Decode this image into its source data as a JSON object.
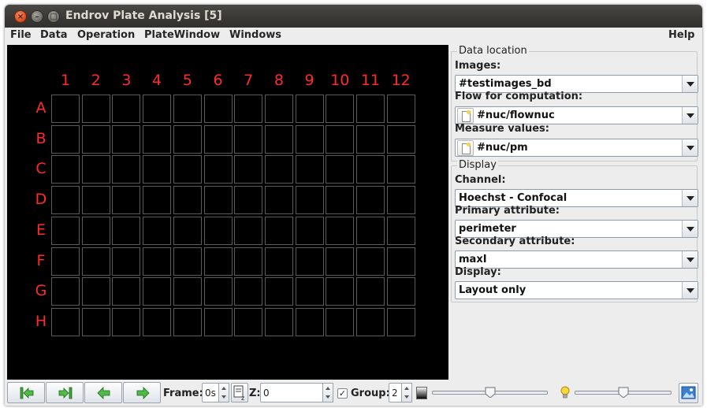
{
  "window": {
    "title": "Endrov Plate Analysis [5]"
  },
  "menu": {
    "file": "File",
    "data": "Data",
    "operation": "Operation",
    "platewindow": "PlateWindow",
    "windows": "Windows",
    "help": "Help"
  },
  "plate": {
    "columns": [
      "1",
      "2",
      "3",
      "4",
      "5",
      "6",
      "7",
      "8",
      "9",
      "10",
      "11",
      "12"
    ],
    "rows": [
      "A",
      "B",
      "C",
      "D",
      "E",
      "F",
      "G",
      "H"
    ],
    "label_color": "#ff2b2b"
  },
  "side": {
    "data_location": {
      "title": "Data location",
      "images_label": "Images:",
      "images_value": "#testimages_bd",
      "flow_label": "Flow for computation:",
      "flow_value": "#nuc/flownuc",
      "measure_label": "Measure values:",
      "measure_value": "#nuc/pm"
    },
    "display": {
      "title": "Display",
      "channel_label": "Channel:",
      "channel_value": "Hoechst - Confocal",
      "primary_label": "Primary attribute:",
      "primary_value": "perimeter",
      "secondary_label": "Secondary attribute:",
      "secondary_value": "maxI",
      "display_label": "Display:",
      "display_value": "Layout only"
    }
  },
  "bottom": {
    "frame_label": "Frame:",
    "frame_value": "0s",
    "z_label": "Z:",
    "z_value": "0",
    "group_label": "Group:",
    "group_value": "2",
    "group_checked": true,
    "contrast_slider": 0.5,
    "brightness_slider": 0.5,
    "icons": [
      "first-frame-icon",
      "last-frame-icon",
      "prev-frame-icon",
      "next-frame-icon",
      "frame-calc-icon",
      "contrast-icon",
      "bulb-icon",
      "image-icon"
    ]
  }
}
